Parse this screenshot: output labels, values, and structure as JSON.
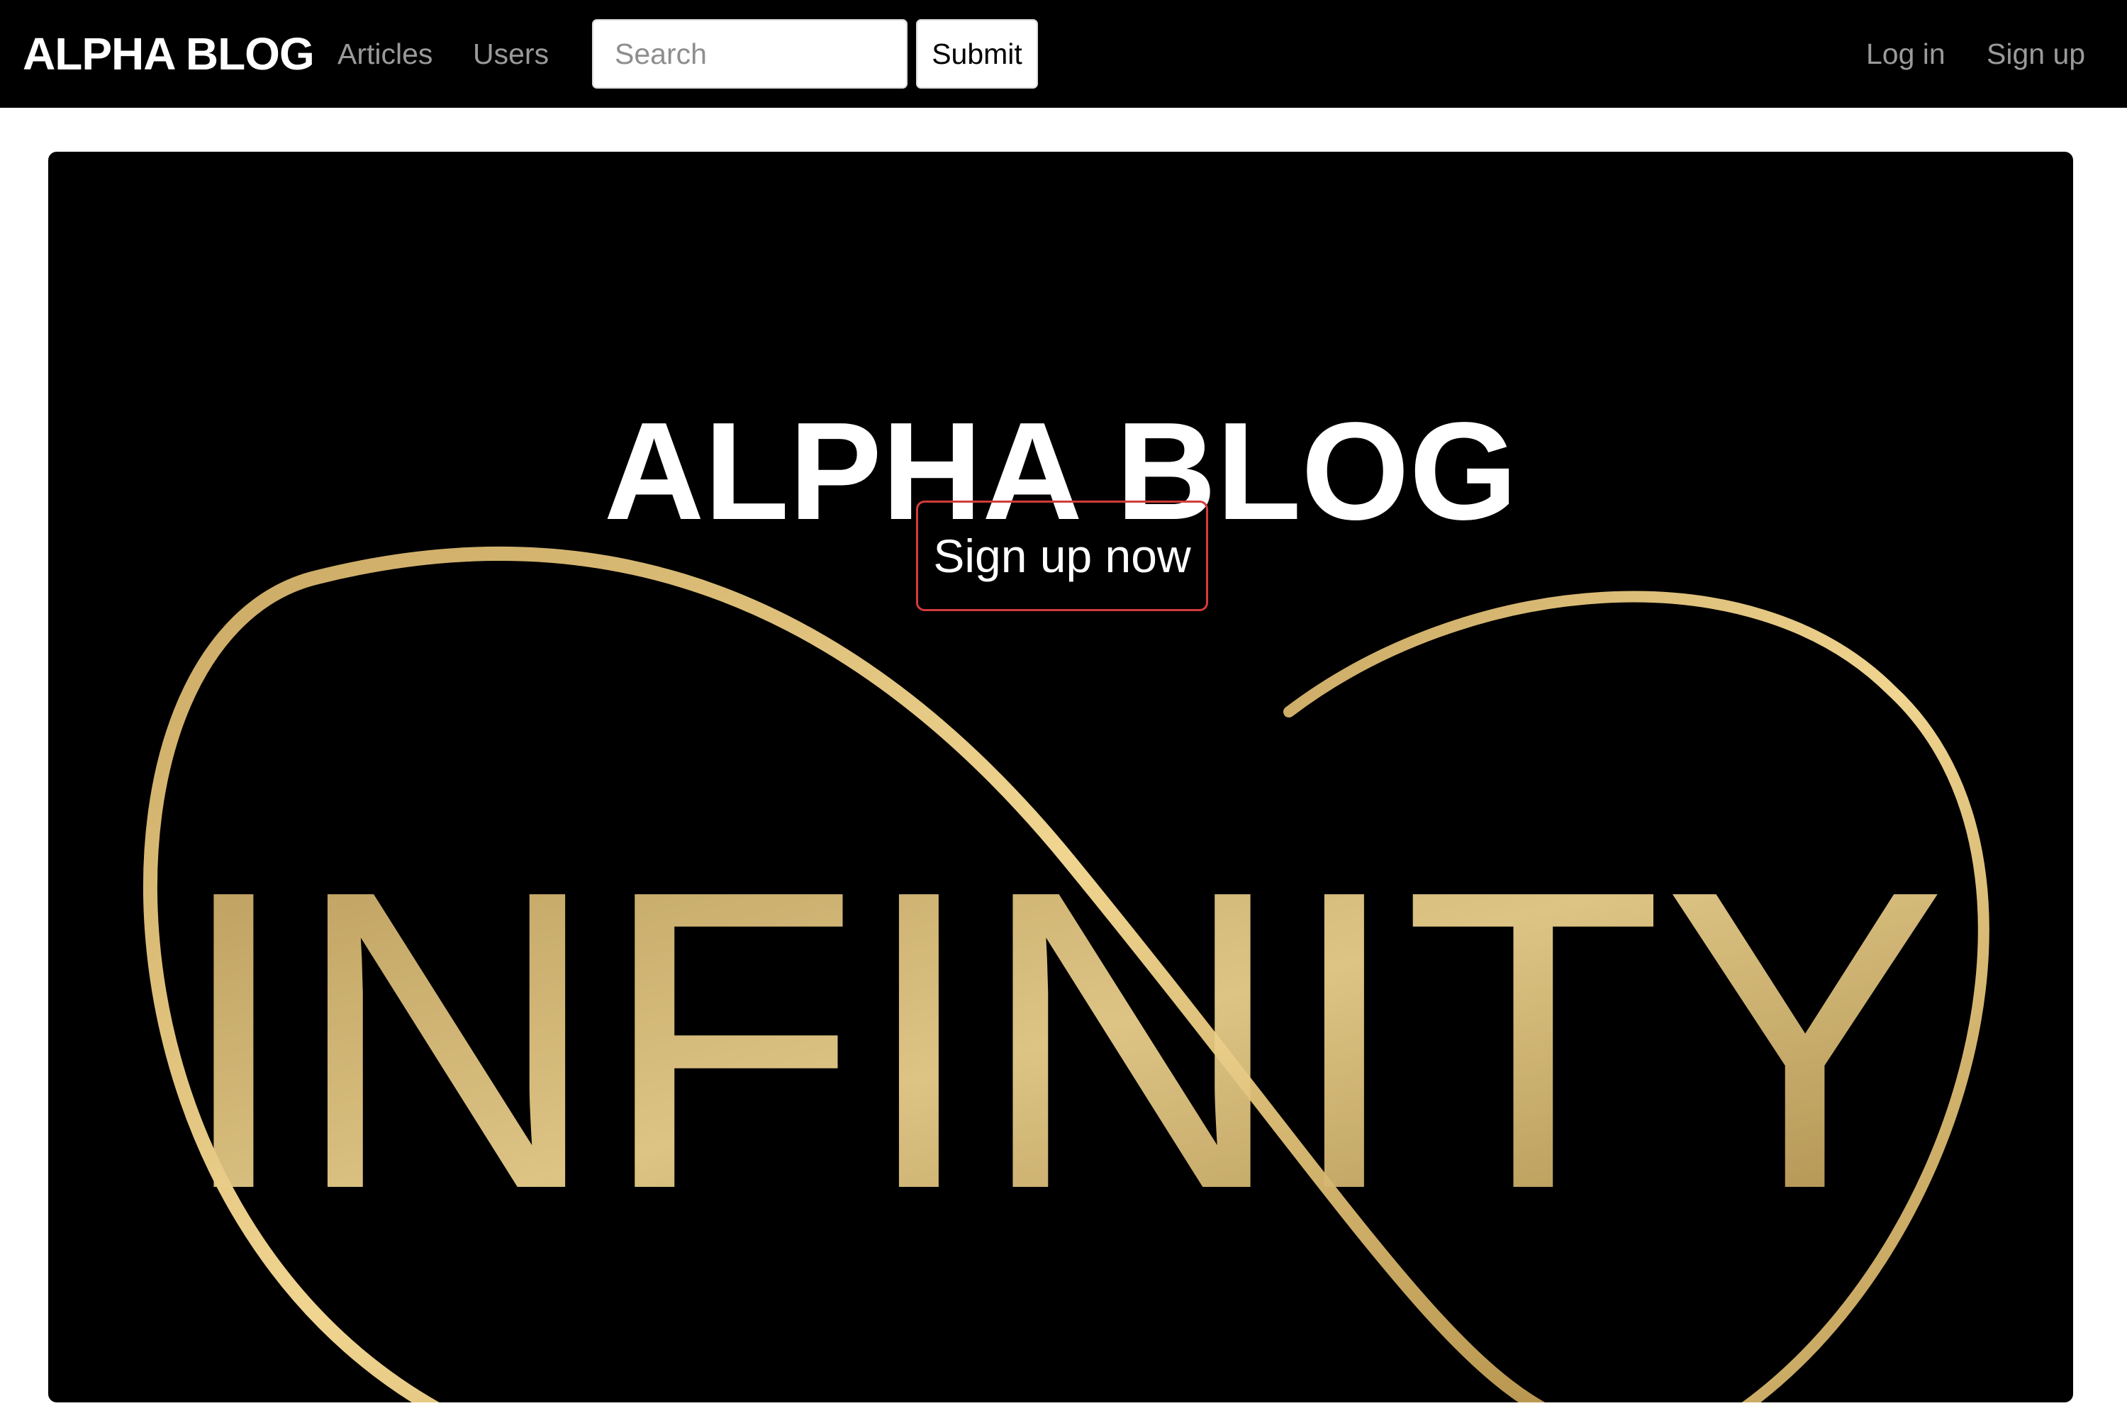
{
  "navbar": {
    "brand": "ALPHA BLOG",
    "links": {
      "articles": "Articles",
      "users": "Users",
      "login": "Log in",
      "signup": "Sign up"
    },
    "search": {
      "placeholder": "Search",
      "value": "",
      "submit_label": "Submit"
    }
  },
  "hero": {
    "title": "ALPHA BLOG",
    "cta_label": "Sign up now",
    "background_logo_text": "INFINITY"
  },
  "colors": {
    "navbar_background": "#000000",
    "link_color": "#9a9a9a",
    "hero_background": "#000000",
    "logo_gold": "#d4b46a",
    "cta_border": "#d33b3b"
  }
}
